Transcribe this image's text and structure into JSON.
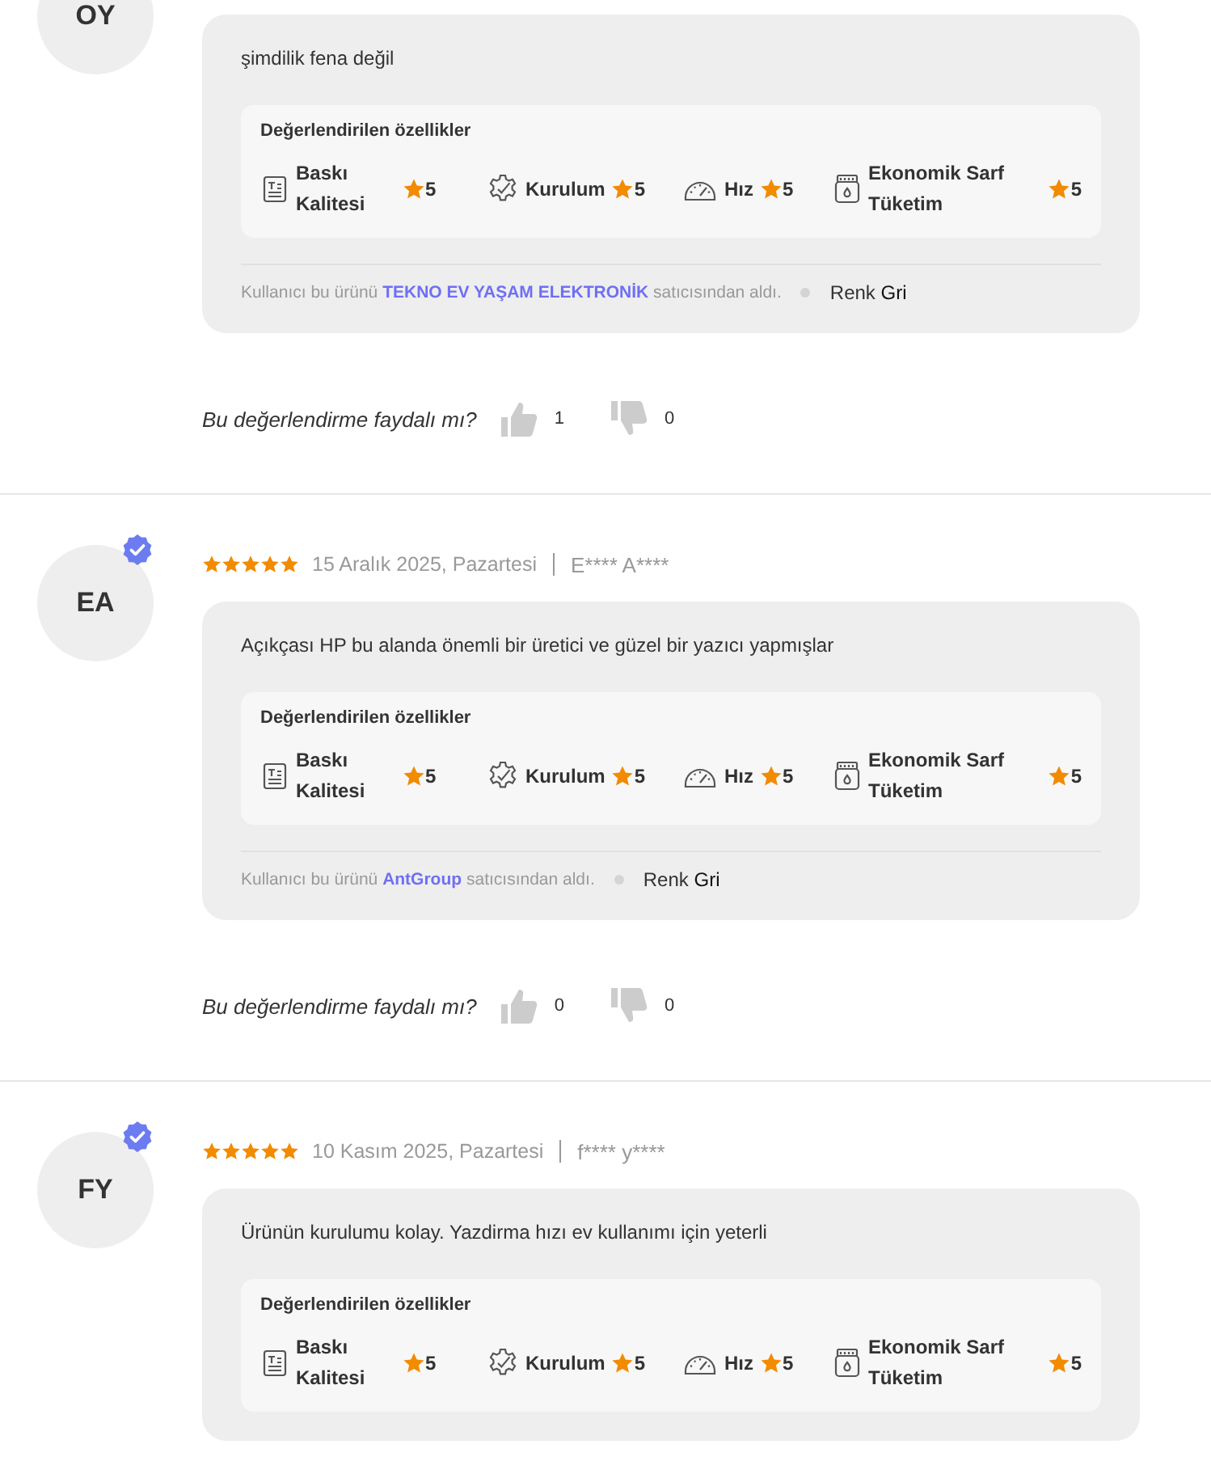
{
  "reviews": [
    {
      "initials": "OY",
      "text": "şimdilik fena değil",
      "features_title": "Değerlendirilen özellikler",
      "features": [
        {
          "kind": "print",
          "label": "Baskı Kalitesi",
          "rating": "5"
        },
        {
          "kind": "gear",
          "label": "Kurulum",
          "rating": "5"
        },
        {
          "kind": "gauge",
          "label": "Hız",
          "rating": "5"
        },
        {
          "kind": "ink",
          "label": "Ekonomik Sarf Tüketim",
          "rating": "5"
        }
      ],
      "seller": {
        "before": "Kullanıcı bu ürünü",
        "name": "TEKNO EV YAŞAM ELEKTRONİK",
        "after": "satıcısından aldı."
      },
      "attribute": {
        "name": "Renk",
        "value": "Gri"
      },
      "helpful": {
        "question": "Bu değerlendirme faydalı mı?",
        "likes": "1",
        "dislikes": "0"
      }
    },
    {
      "initials": "EA",
      "verified": true,
      "stars": 5,
      "date": "15 Aralık 2025, Pazartesi",
      "author": "E**** A****",
      "text": "Açıkçası HP bu alanda önemli bir üretici ve güzel bir yazıcı yapmışlar",
      "features_title": "Değerlendirilen özellikler",
      "features": [
        {
          "kind": "print",
          "label": "Baskı Kalitesi",
          "rating": "5"
        },
        {
          "kind": "gear",
          "label": "Kurulum",
          "rating": "5"
        },
        {
          "kind": "gauge",
          "label": "Hız",
          "rating": "5"
        },
        {
          "kind": "ink",
          "label": "Ekonomik Sarf Tüketim",
          "rating": "5"
        }
      ],
      "seller": {
        "before": "Kullanıcı bu ürünü",
        "name": "AntGroup",
        "after": "satıcısından aldı."
      },
      "attribute": {
        "name": "Renk",
        "value": "Gri"
      },
      "helpful": {
        "question": "Bu değerlendirme faydalı mı?",
        "likes": "0",
        "dislikes": "0"
      }
    },
    {
      "initials": "FY",
      "verified": true,
      "stars": 5,
      "date": "10 Kasım 2025, Pazartesi",
      "author": "f**** y****",
      "text": "Ürünün kurulumu kolay. Yazdirma hızı ev kullanımı için yeterli",
      "features_title": "Değerlendirilen özellikler",
      "features": [
        {
          "kind": "print",
          "label": "Baskı Kalitesi",
          "rating": "5"
        },
        {
          "kind": "gear",
          "label": "Kurulum",
          "rating": "5"
        },
        {
          "kind": "gauge",
          "label": "Hız",
          "rating": "5"
        },
        {
          "kind": "ink",
          "label": "Ekonomik Sarf Tüketim",
          "rating": "5"
        }
      ]
    }
  ]
}
